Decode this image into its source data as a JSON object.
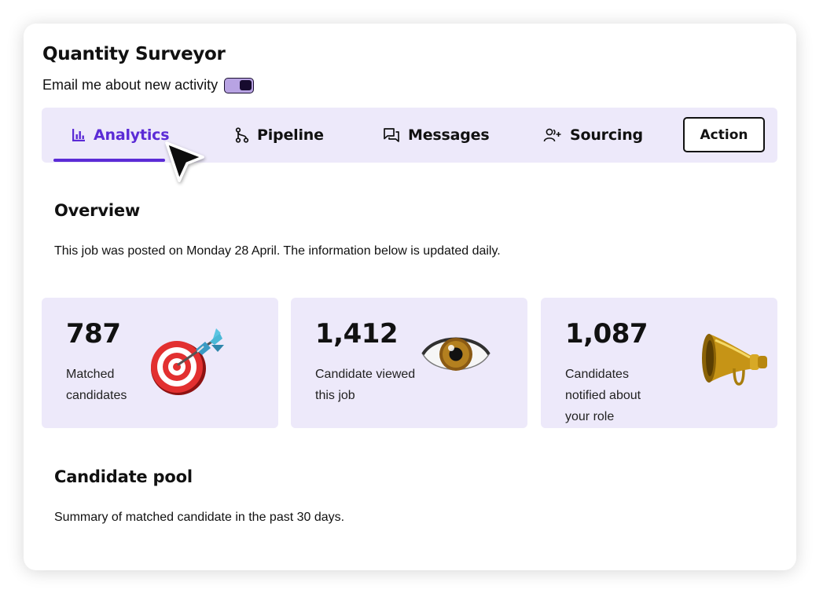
{
  "job": {
    "title": "Quantity Surveyor",
    "email_toggle_label": "Email me about new activity",
    "email_toggle_on": true
  },
  "tabs": [
    {
      "label": "Analytics",
      "icon": "bar-chart-icon",
      "active": true
    },
    {
      "label": "Pipeline",
      "icon": "branch-icon",
      "active": false
    },
    {
      "label": "Messages",
      "icon": "chat-icon",
      "active": false
    },
    {
      "label": "Sourcing",
      "icon": "add-user-icon",
      "active": false
    }
  ],
  "action_label": "Action",
  "overview": {
    "title": "Overview",
    "description": "This job was posted on Monday 28 April. The information below is updated daily."
  },
  "stats": [
    {
      "value": "787",
      "label": "Matched candidates",
      "icon": "target-icon"
    },
    {
      "value": "1,412",
      "label": "Candidate viewed this job",
      "icon": "eye-icon"
    },
    {
      "value": "1,087",
      "label": "Candidates notified about your role",
      "icon": "megaphone-icon"
    }
  ],
  "candidate_pool": {
    "title": "Candidate pool",
    "description": "Summary of matched candidate in the past 30 days."
  },
  "colors": {
    "accent": "#5b2bd6",
    "tab_bar_bg": "#ede9fa",
    "toggle_track": "#b8a3e3",
    "toggle_knob": "#170b2e"
  }
}
